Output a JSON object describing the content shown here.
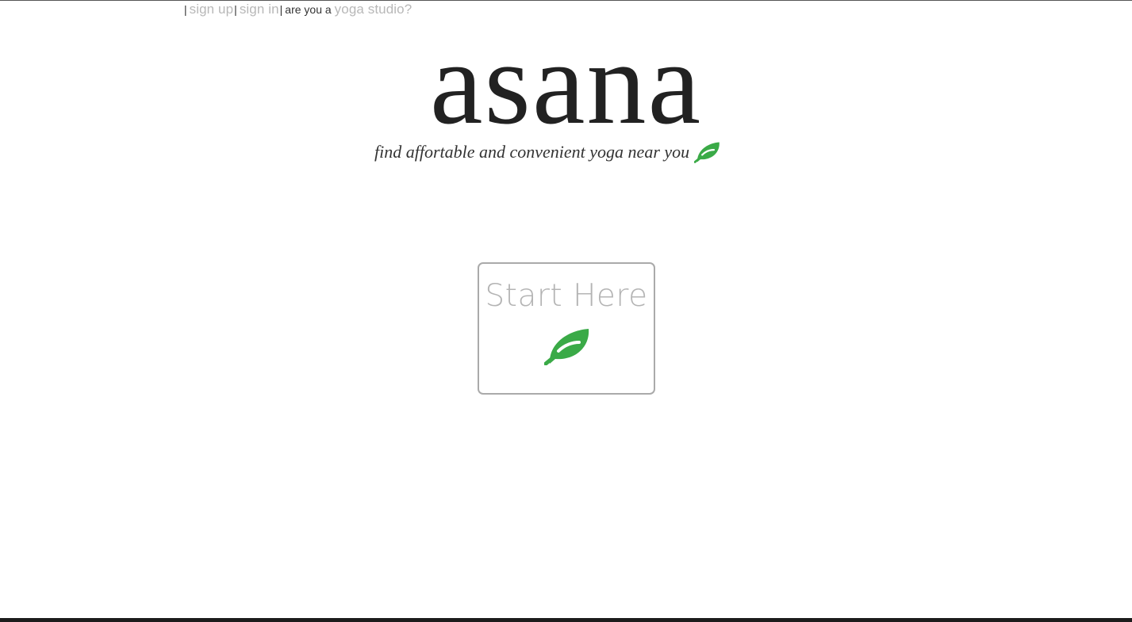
{
  "nav": {
    "separator": "|",
    "sign_up": "sign up",
    "sign_in": "sign in",
    "studio_prompt": "are you a",
    "studio_link": "yoga studio?"
  },
  "brand": {
    "logo": "asana",
    "tagline": "find affortable and convenient yoga near you",
    "leaf_icon": "leaf-icon",
    "accent_color": "#3aaa47"
  },
  "cta": {
    "label": "Start Here",
    "icon": "leaf-icon"
  }
}
